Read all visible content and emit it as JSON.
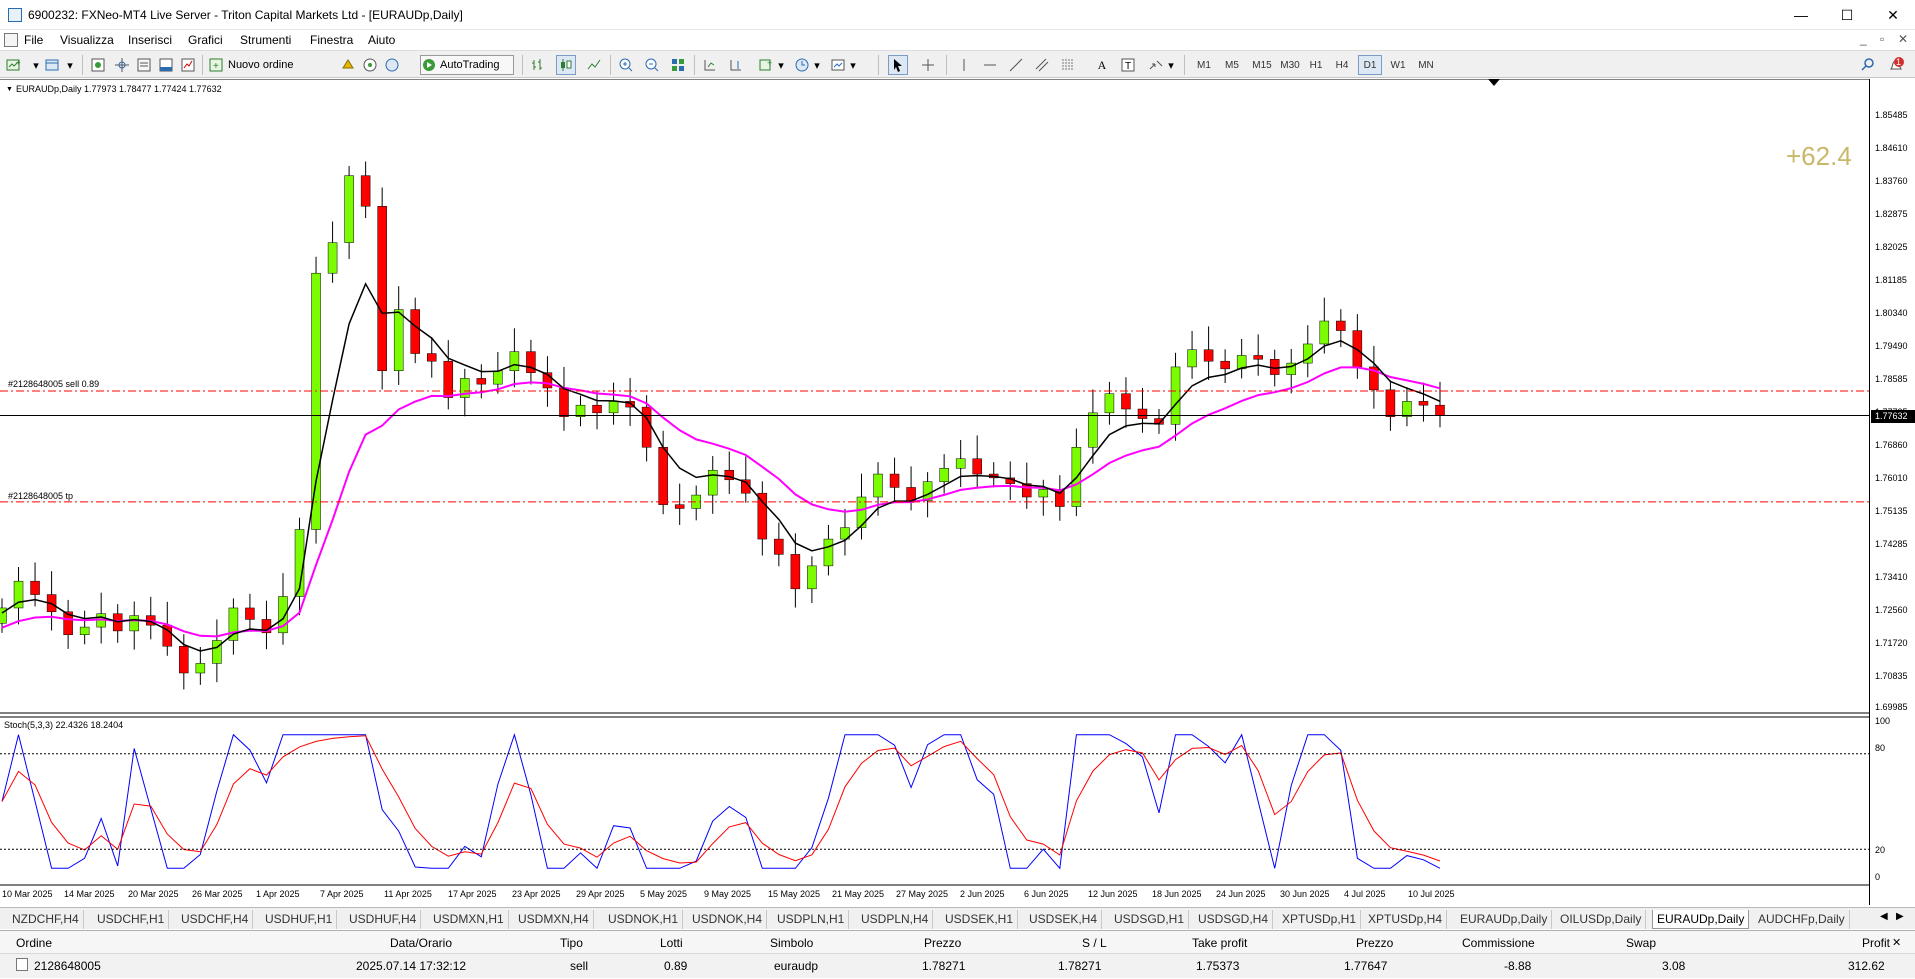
{
  "window": {
    "title": "6900232: FXNeo-MT4 Live Server - Triton Capital Markets Ltd - [EURAUDp,Daily]",
    "minimize": "—",
    "maximize": "☐",
    "close": "✕"
  },
  "menu": {
    "items": [
      "File",
      "Visualizza",
      "Inserisci",
      "Grafici",
      "Strumenti",
      "Finestra",
      "Aiuto"
    ],
    "right": [
      "_",
      "▫",
      "✕"
    ]
  },
  "toolbar": {
    "new_order": "Nuovo ordine",
    "autotrading": "AutoTrading",
    "timeframes": [
      "M1",
      "M5",
      "M15",
      "M30",
      "H1",
      "H4",
      "D1",
      "W1",
      "MN"
    ],
    "alert_count": "1"
  },
  "chart": {
    "symbol_info": "EURAUDp,Daily  1.77973 1.78477 1.77424 1.77632",
    "profit_label": "+62.4",
    "order_sell_label": "#2128648005 sell 0.89",
    "order_tp_label": "#2128648005 tp",
    "current_price": "1.77632",
    "stoch_label": "Stoch(5,3,3) 22.4326 18.2404",
    "price_ticks": [
      "1.85485",
      "1.84610",
      "1.83760",
      "1.82875",
      "1.82025",
      "1.81185",
      "1.80340",
      "1.79490",
      "1.78585",
      "1.77735",
      "1.76860",
      "1.76010",
      "1.75135",
      "1.74285",
      "1.73410",
      "1.72560",
      "1.71720",
      "1.70835",
      "1.69985"
    ],
    "stoch_ticks": [
      "100",
      "80",
      "20",
      "0"
    ],
    "date_ticks": [
      "10 Mar 2025",
      "14 Mar 2025",
      "20 Mar 2025",
      "26 Mar 2025",
      "1 Apr 2025",
      "7 Apr 2025",
      "11 Apr 2025",
      "17 Apr 2025",
      "23 Apr 2025",
      "29 Apr 2025",
      "5 May 2025",
      "9 May 2025",
      "15 May 2025",
      "21 May 2025",
      "27 May 2025",
      "2 Jun 2025",
      "6 Jun 2025",
      "12 Jun 2025",
      "18 Jun 2025",
      "24 Jun 2025",
      "30 Jun 2025",
      "4 Jul 2025",
      "10 Jul 2025"
    ],
    "colors": {
      "bull": "#7cfc00",
      "bear": "#ff0000",
      "ma_fast": "#000000",
      "ma_slow": "#ff00ff",
      "stoch_main": "#0000ff",
      "stoch_signal": "#ff0000",
      "order_line": "#ff0000",
      "profit": "#c8b86a"
    }
  },
  "tabs": [
    "NZDCHF,H4",
    "USDCHF,H1",
    "USDCHF,H4",
    "USDHUF,H1",
    "USDHUF,H4",
    "USDMXN,H1",
    "USDMXN,H4",
    "USDNOK,H1",
    "USDNOK,H4",
    "USDPLN,H1",
    "USDPLN,H4",
    "USDSEK,H1",
    "USDSEK,H4",
    "USDSGD,H1",
    "USDSGD,H4",
    "XPTUSDp,H1",
    "XPTUSDp,H4",
    "EURAUDp,Daily",
    "OILUSDp,Daily",
    "EURAUDp,Daily",
    "AUDCHFp,Daily"
  ],
  "terminal": {
    "headers": [
      "Ordine",
      "Data/Orario",
      "Tipo",
      "Lotti",
      "Simbolo",
      "Prezzo",
      "S / L",
      "Take profit",
      "Prezzo",
      "Commissione",
      "Swap",
      "Profit"
    ],
    "row": [
      "2128648005",
      "2025.07.14 17:32:12",
      "sell",
      "0.89",
      "euraudp",
      "1.78271",
      "1.78271",
      "1.75373",
      "1.77647",
      "-8.88",
      "3.08",
      "312.62"
    ]
  }
}
